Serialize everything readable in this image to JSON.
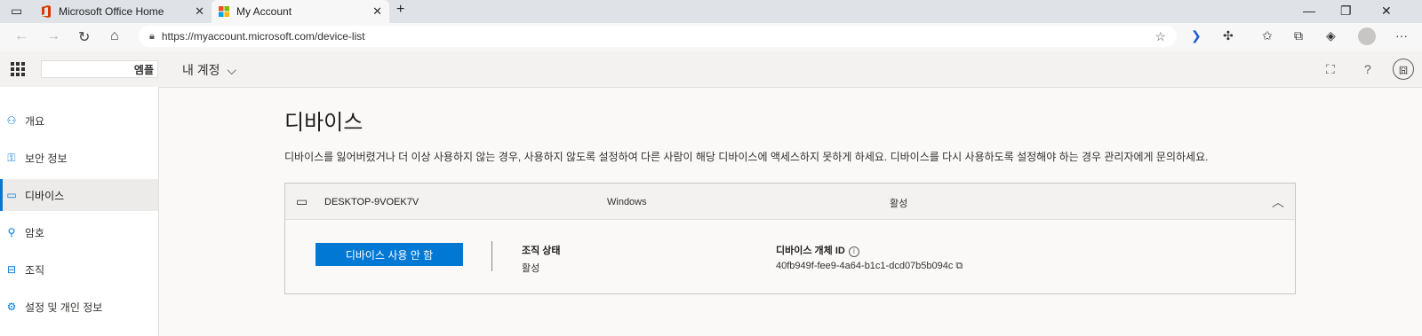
{
  "browser": {
    "tabs": [
      {
        "title": "Microsoft Office Home",
        "close": "✕"
      },
      {
        "title": "My Account",
        "close": "✕"
      }
    ],
    "new_tab": "+",
    "window_controls": {
      "minimize": "—",
      "restore": "❐",
      "close": "✕"
    },
    "address": {
      "url": "https://myaccount.microsoft.com/device-list"
    },
    "more": "···"
  },
  "app_header": {
    "logo_text": "엠플",
    "app_name": "내 계정",
    "app_name_chevron": "⌵",
    "help": "?",
    "profile_initial": "囧"
  },
  "sidebar": {
    "items": [
      {
        "label": "개요",
        "icon": "person-icon"
      },
      {
        "label": "보안 정보",
        "icon": "security-info-icon"
      },
      {
        "label": "디바이스",
        "icon": "laptop-icon",
        "active": true
      },
      {
        "label": "암호",
        "icon": "key-icon"
      },
      {
        "label": "조직",
        "icon": "briefcase-icon"
      },
      {
        "label": "설정 및 개인 정보",
        "icon": "gear-icon"
      }
    ]
  },
  "main": {
    "title": "디바이스",
    "description": "디바이스를 잃어버렸거나 더 이상 사용하지 않는 경우, 사용하지 않도록 설정하여 다른 사람이 해당 디바이스에 액세스하지 못하게 하세요. 디바이스를 다시 사용하도록 설정해야 하는 경우 관리자에게 문의하세요."
  },
  "device": {
    "name": "DESKTOP-9VOEK7V",
    "os": "Windows",
    "status": "활성",
    "disable_button": "디바이스 사용 안 함",
    "org_state_label": "조직 상태",
    "org_state_value": "활성",
    "object_id_label": "디바이스 개체 ID",
    "object_id_value": "40fb949f-fee9-4a64-b1c1-dcd07b5b094c"
  },
  "colors": {
    "accent": "#0078d4",
    "tabbar": "#dfe3e8",
    "header_bg": "#f3f2f1"
  }
}
